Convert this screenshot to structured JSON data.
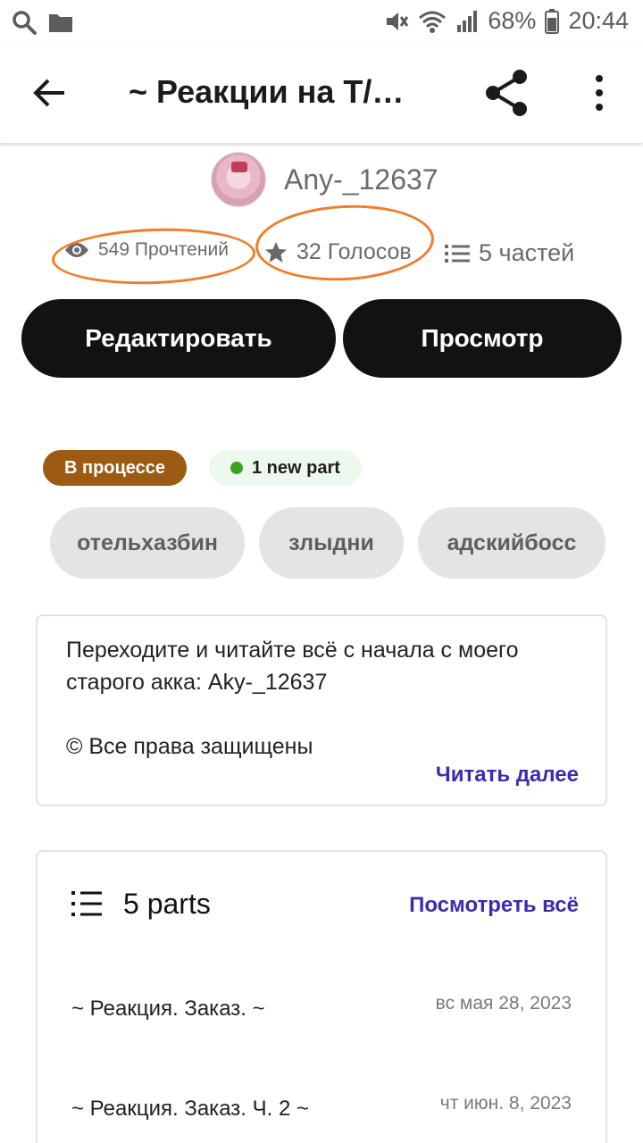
{
  "status_bar": {
    "battery": "68%",
    "time": "20:44",
    "icons": [
      "search-icon",
      "folder-icon",
      "mute-icon",
      "wifi-icon",
      "signal-icon",
      "battery-icon"
    ]
  },
  "app_bar": {
    "title": "~ Реакции на Т/…",
    "icons": [
      "back-arrow-icon",
      "share-icon",
      "more-vert-icon"
    ]
  },
  "author": {
    "name": "Any-_12637"
  },
  "stats": {
    "reads": "549 Прочтений",
    "votes": "32 Голосов",
    "parts": "5 частей",
    "highlight_color": "#f07d2a"
  },
  "actions": {
    "edit": "Редактировать",
    "view": "Просмотр"
  },
  "badges": {
    "status": "В процессе",
    "new_part": "1 new part",
    "status_color": "#9c5a12",
    "new_dot_color": "#3ba31c"
  },
  "tags": [
    "отельхазбин",
    "злыдни",
    "адскийбосс"
  ],
  "description": {
    "text": "Переходите и читайте всё с начала с моего\nстарого акка: Aky-_12637\n\n© Все права защищены",
    "read_more": "Читать далее"
  },
  "parts": {
    "title": "5 parts",
    "see_all": "Посмотреть всё",
    "items": [
      {
        "title": "~ Реакция. Заказ. ~",
        "date": "вс мая 28, 2023"
      },
      {
        "title": "~ Реакция. Заказ. Ч. 2 ~",
        "date": "чт июн. 8, 2023"
      }
    ]
  },
  "colors": {
    "link": "#3d2bb0",
    "button_bg": "#121212"
  }
}
